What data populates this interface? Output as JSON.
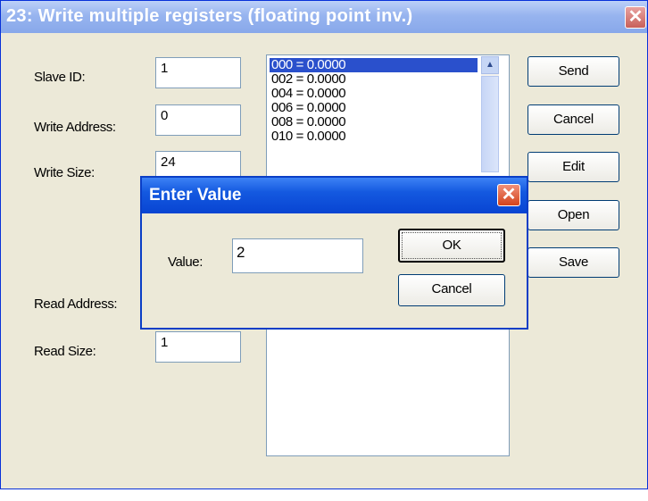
{
  "window": {
    "title": "23: Write multiple registers (floating point inv.)",
    "close_glyph": "✕"
  },
  "form": {
    "slave_id_label": "Slave ID:",
    "slave_id_value": "1",
    "write_address_label": "Write Address:",
    "write_address_value": "0",
    "write_size_label": "Write Size:",
    "write_size_value": "24",
    "read_address_label": "Read Address:",
    "read_size_label": "Read Size:",
    "read_size_value": "1"
  },
  "register_list": {
    "items": [
      "000 = 0.0000",
      "002 = 0.0000",
      "004 = 0.0000",
      "006 = 0.0000",
      "008 = 0.0000",
      "010 = 0.0000"
    ],
    "selected_index": 0,
    "scroll_up_glyph": "▲"
  },
  "buttons": {
    "send": "Send",
    "cancel": "Cancel",
    "edit": "Edit",
    "open": "Open",
    "save": "Save"
  },
  "dialog": {
    "title": "Enter Value",
    "close_glyph": "✕",
    "value_label": "Value:",
    "value_input": "2",
    "ok": "OK",
    "cancel": "Cancel"
  },
  "colors": {
    "window_bg": "#ece9d8",
    "selection": "#2a50cc",
    "dialog_titlebar": "#1459e0",
    "close_button": "#d3431c"
  }
}
